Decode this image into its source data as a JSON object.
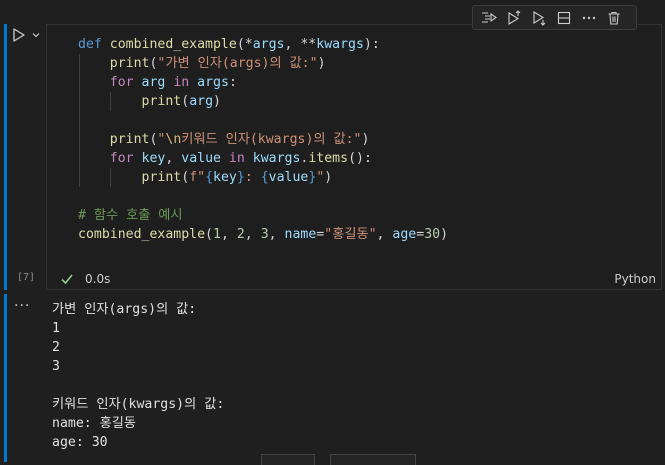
{
  "cell": {
    "execution_count": "[7]",
    "status_time": "0.0s",
    "language": "Python"
  },
  "code": {
    "l1": {
      "kw": "def",
      "fn": "combined_example",
      "p1": "(*",
      "a1": "args",
      "p2": ", **",
      "a2": "kwargs",
      "p3": "):"
    },
    "l2": {
      "fn": "print",
      "p1": "(",
      "s1": "\"가변 인자(args)의 값:\"",
      "p2": ")"
    },
    "l3": {
      "kw": "for",
      "v1": "arg",
      "kw2": "in",
      "v2": "args",
      "p": ":"
    },
    "l4": {
      "fn": "print",
      "p1": "(",
      "v": "arg",
      "p2": ")"
    },
    "l6": {
      "fn": "print",
      "p1": "(",
      "s1": "\"",
      "esc": "\\n",
      "s2": "키워드 인자(kwargs)의 값:\"",
      "p2": ")"
    },
    "l7": {
      "kw": "for",
      "v1": "key",
      "p1": ", ",
      "v2": "value",
      "kw2": "in",
      "v3": "kwargs",
      "p2": ".",
      "fn": "items",
      "p3": "():"
    },
    "l8": {
      "fn": "print",
      "p1": "(",
      "fs": "f\"",
      "b1": "{",
      "v1": "key",
      "b2": "}",
      "s1": ": ",
      "b3": "{",
      "v2": "value",
      "b4": "}",
      "s2": "\"",
      "p2": ")"
    },
    "l10": {
      "cmt": "# 함수 호출 예시"
    },
    "l11": {
      "fn": "combined_example",
      "p1": "(",
      "n1": "1",
      "c1": ", ",
      "n2": "2",
      "c2": ", ",
      "n3": "3",
      "c3": ", ",
      "k1": "name",
      "eq1": "=",
      "s1": "\"홍길동\"",
      "c4": ", ",
      "k2": "age",
      "eq2": "=",
      "n4": "30",
      "p2": ")"
    }
  },
  "output": {
    "lines": [
      "가변 인자(args)의 값:",
      "1",
      "2",
      "3",
      "",
      "키워드 인자(kwargs)의 값:",
      "name: 홍길동",
      "age: 30"
    ]
  },
  "toolbar": {
    "icons": [
      "run-by-line-icon",
      "execute-above-icon",
      "execute-below-icon",
      "split-cell-icon",
      "more-icon",
      "delete-icon"
    ]
  },
  "colors": {
    "accent": "#0078d4",
    "success": "#89d185",
    "background": "#1f1f1f"
  }
}
